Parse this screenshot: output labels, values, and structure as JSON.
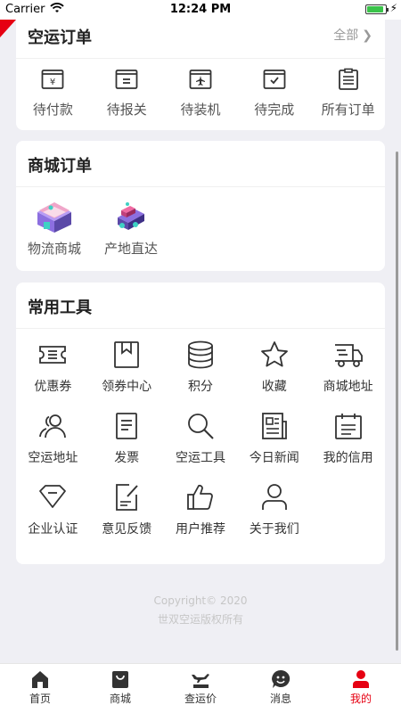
{
  "status_bar": {
    "carrier": "Carrier",
    "time": "12:24 PM",
    "battery_level": 0.9
  },
  "air_orders": {
    "title": "空运订单",
    "more": "全部",
    "items": [
      {
        "label": "待付款",
        "icon": "yen-card-icon"
      },
      {
        "label": "待报关",
        "icon": "declaration-icon"
      },
      {
        "label": "待装机",
        "icon": "airplane-box-icon"
      },
      {
        "label": "待完成",
        "icon": "check-box-icon"
      },
      {
        "label": "所有订单",
        "icon": "clipboard-list-icon"
      }
    ]
  },
  "mall_orders": {
    "title": "商城订单",
    "items": [
      {
        "label": "物流商城",
        "icon": "store-icon"
      },
      {
        "label": "产地直达",
        "icon": "delivery-truck-icon"
      }
    ]
  },
  "tools": {
    "title": "常用工具",
    "items": [
      {
        "label": "优惠券",
        "icon": "coupon-icon"
      },
      {
        "label": "领券中心",
        "icon": "bookmark-book-icon"
      },
      {
        "label": "积分",
        "icon": "coin-stack-icon"
      },
      {
        "label": "收藏",
        "icon": "star-icon"
      },
      {
        "label": "商城地址",
        "icon": "truck-address-icon"
      },
      {
        "label": "空运地址",
        "icon": "people-icon"
      },
      {
        "label": "发票",
        "icon": "invoice-icon"
      },
      {
        "label": "空运工具",
        "icon": "search-icon"
      },
      {
        "label": "今日新闻",
        "icon": "newspaper-icon"
      },
      {
        "label": "我的信用",
        "icon": "calendar-credit-icon"
      },
      {
        "label": "企业认证",
        "icon": "diamond-icon"
      },
      {
        "label": "意见反馈",
        "icon": "edit-document-icon"
      },
      {
        "label": "用户推荐",
        "icon": "thumbs-up-icon"
      },
      {
        "label": "关于我们",
        "icon": "user-icon"
      }
    ]
  },
  "footer": {
    "line1": "Copyright© 2020",
    "line2": "世双空运版权所有"
  },
  "tabbar": {
    "items": [
      {
        "label": "首页",
        "icon": "home-icon",
        "active": false
      },
      {
        "label": "商城",
        "icon": "shop-bag-icon",
        "active": false
      },
      {
        "label": "查运价",
        "icon": "freight-plane-icon",
        "active": false
      },
      {
        "label": "消息",
        "icon": "message-smile-icon",
        "active": false
      },
      {
        "label": "我的",
        "icon": "profile-icon",
        "active": true
      }
    ]
  },
  "colors": {
    "accent": "#e60012",
    "background": "#efeff4",
    "icon": "#333333"
  }
}
